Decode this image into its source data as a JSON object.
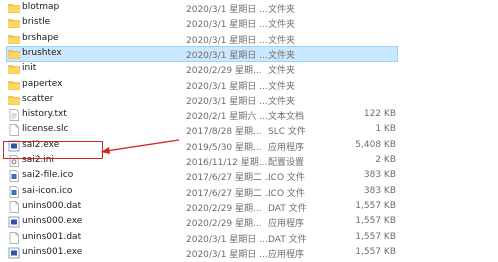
{
  "colors": {
    "folder": "#f6c54a",
    "selection": "#cce8ff",
    "callout": "#d42525"
  },
  "files": [
    {
      "name": "blotmap",
      "date": "2020/3/1 星期日 ...",
      "type": "文件夹",
      "size": "",
      "icon": "folder-icon",
      "selected": false
    },
    {
      "name": "bristle",
      "date": "2020/3/1 星期日 ...",
      "type": "文件夹",
      "size": "",
      "icon": "folder-icon",
      "selected": false
    },
    {
      "name": "brshape",
      "date": "2020/3/1 星期日 ...",
      "type": "文件夹",
      "size": "",
      "icon": "folder-icon",
      "selected": false
    },
    {
      "name": "brushtex",
      "date": "2020/3/1 星期日 ...",
      "type": "文件夹",
      "size": "",
      "icon": "folder-icon",
      "selected": true
    },
    {
      "name": "init",
      "date": "2020/2/29 星期...",
      "type": "文件夹",
      "size": "",
      "icon": "folder-icon",
      "selected": false
    },
    {
      "name": "papertex",
      "date": "2020/3/1 星期日 ...",
      "type": "文件夹",
      "size": "",
      "icon": "folder-icon",
      "selected": false
    },
    {
      "name": "scatter",
      "date": "2020/3/1 星期日 ...",
      "type": "文件夹",
      "size": "",
      "icon": "folder-icon",
      "selected": false
    },
    {
      "name": "history.txt",
      "date": "2020/2/1 星期六 ...",
      "type": "文本文档",
      "size": "122 KB",
      "icon": "text-file-icon",
      "selected": false
    },
    {
      "name": "license.slc",
      "date": "2017/8/28 星期...",
      "type": "SLC 文件",
      "size": "1 KB",
      "icon": "file-icon",
      "selected": false
    },
    {
      "name": "sai2.exe",
      "date": "2019/5/30 星期...",
      "type": "应用程序",
      "size": "5,408 KB",
      "icon": "exe-icon",
      "selected": false
    },
    {
      "name": "sai2.ini",
      "date": "2016/11/12 星期...",
      "type": "配置设置",
      "size": "2 KB",
      "icon": "ini-icon",
      "selected": false
    },
    {
      "name": "sai2-file.ico",
      "date": "2017/6/27 星期二 ...",
      "type": "ICO 文件",
      "size": "383 KB",
      "icon": "ico-icon",
      "selected": false
    },
    {
      "name": "sai-icon.ico",
      "date": "2017/6/27 星期二 ...",
      "type": "ICO 文件",
      "size": "383 KB",
      "icon": "ico-icon",
      "selected": false
    },
    {
      "name": "unins000.dat",
      "date": "2020/2/29 星期...",
      "type": "DAT 文件",
      "size": "1,557 KB",
      "icon": "file-icon",
      "selected": false
    },
    {
      "name": "unins000.exe",
      "date": "2020/2/29 星期...",
      "type": "应用程序",
      "size": "1,557 KB",
      "icon": "exe-icon",
      "selected": false
    },
    {
      "name": "unins001.dat",
      "date": "2020/3/1 星期日 ...",
      "type": "DAT 文件",
      "size": "1,557 KB",
      "icon": "file-icon",
      "selected": false
    },
    {
      "name": "unins001.exe",
      "date": "2020/3/1 星期日 ...",
      "type": "应用程序",
      "size": "1,557 KB",
      "icon": "exe-icon",
      "selected": false
    }
  ]
}
